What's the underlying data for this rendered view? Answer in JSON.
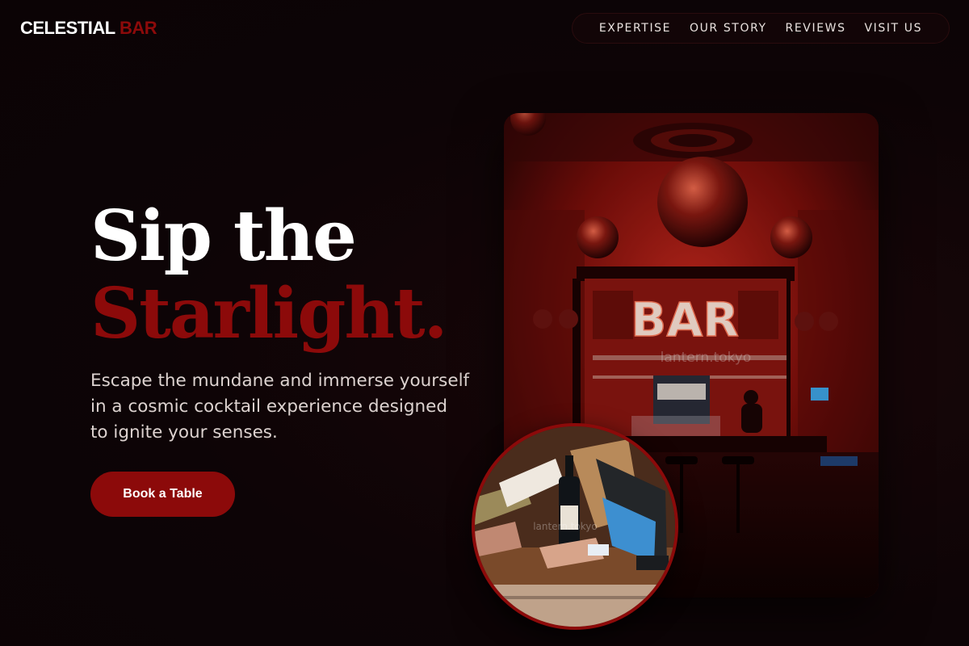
{
  "brand": {
    "name": "CELESTIAL",
    "accent": "BAR"
  },
  "nav": {
    "items": [
      {
        "label": "EXPERTISE"
      },
      {
        "label": "OUR STORY"
      },
      {
        "label": "REVIEWS"
      },
      {
        "label": "VISIT US"
      }
    ]
  },
  "hero": {
    "line1": "Sip the",
    "line2": "Starlight.",
    "lead": "Escape the mundane and immerse yourself in a cosmic cocktail experience designed to ignite your senses.",
    "cta_label": "Book a Table"
  },
  "images": {
    "main_sign": "BAR",
    "main_watermark": "lantern.tokyo",
    "inset_watermark": "lantern.tokyo"
  },
  "colors": {
    "background": "#0d0406",
    "accent": "#8c0a0a",
    "text": "#ffffff"
  }
}
